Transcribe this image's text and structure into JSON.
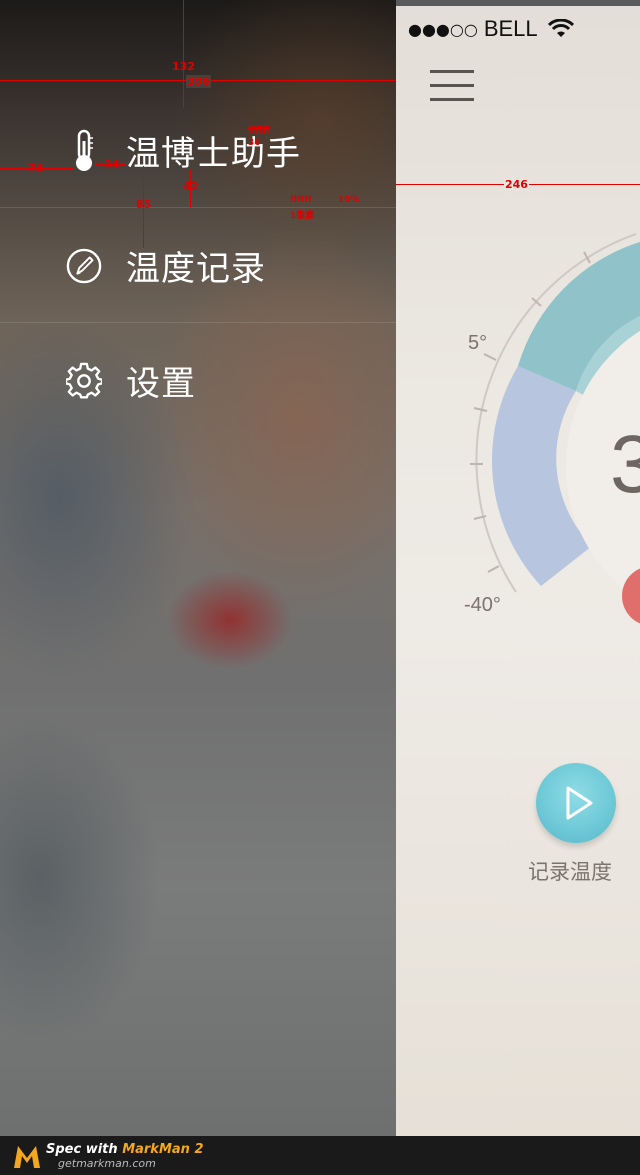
{
  "drawer": {
    "items": [
      {
        "label": "温博士助手",
        "icon": "thermometer-icon"
      },
      {
        "label": "温度记录",
        "icon": "compass-pen-icon"
      },
      {
        "label": "设置",
        "icon": "gear-icon"
      }
    ]
  },
  "spec": {
    "top": "132",
    "width": "396",
    "left_margin": "74",
    "icon_gap": "34",
    "row_height": "85",
    "text_gap": "42",
    "text_color_note": "ffffff",
    "text_size_note": "36",
    "divider_note_color": "ffffff",
    "divider_note_opacity": "10%",
    "divider_note_width": "1像素",
    "main_gap": "246"
  },
  "status_bar": {
    "signal": "●●●○○",
    "carrier": "BELL"
  },
  "gauge": {
    "label_top": "5°",
    "label_bottom": "-40°",
    "reading_partial": "3"
  },
  "actions": {
    "record_label": "记录温度"
  },
  "footer": {
    "line1_prefix": "Spec with ",
    "line1_brand": "MarkMan 2",
    "line2": "getmarkman.com"
  },
  "colors": {
    "drawer_text": "#ffffff",
    "gauge_teal": "#8fc3c9",
    "gauge_blue": "#b8c5de",
    "play_button": "#6cc8d6",
    "spec_red": "#e00000",
    "footer_bg": "#1a1a1a"
  }
}
